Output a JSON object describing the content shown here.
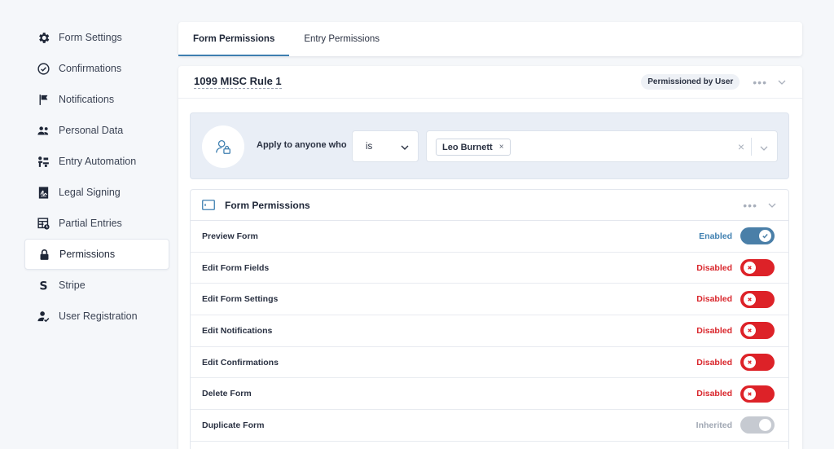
{
  "sidebar": {
    "items": [
      {
        "label": "Form Settings",
        "icon": "gear-icon"
      },
      {
        "label": "Confirmations",
        "icon": "check-circle-icon"
      },
      {
        "label": "Notifications",
        "icon": "flag-icon"
      },
      {
        "label": "Personal Data",
        "icon": "users-icon"
      },
      {
        "label": "Entry Automation",
        "icon": "automation-icon"
      },
      {
        "label": "Legal Signing",
        "icon": "signature-icon"
      },
      {
        "label": "Partial Entries",
        "icon": "partial-entries-icon"
      },
      {
        "label": "Permissions",
        "icon": "lock-icon"
      },
      {
        "label": "Stripe",
        "icon": "stripe-icon"
      },
      {
        "label": "User Registration",
        "icon": "user-check-icon"
      }
    ],
    "active": "Permissions"
  },
  "tabs": [
    {
      "label": "Form Permissions",
      "active": true
    },
    {
      "label": "Entry Permissions",
      "active": false
    }
  ],
  "rule": {
    "title": "1099 MISC Rule 1",
    "badge": "Permissioned by User",
    "condition": {
      "label": "Apply to anyone who",
      "operator": "is",
      "values": [
        "Leo Burnett"
      ],
      "chip_remove": "×",
      "clear": "×"
    },
    "permissions": {
      "title": "Form Permissions",
      "rows": [
        {
          "name": "Preview Form",
          "status": "Enabled",
          "state": "enabled"
        },
        {
          "name": "Edit Form Fields",
          "status": "Disabled",
          "state": "disabled"
        },
        {
          "name": "Edit Form Settings",
          "status": "Disabled",
          "state": "disabled"
        },
        {
          "name": "Edit Notifications",
          "status": "Disabled",
          "state": "disabled"
        },
        {
          "name": "Edit Confirmations",
          "status": "Disabled",
          "state": "disabled"
        },
        {
          "name": "Delete Form",
          "status": "Disabled",
          "state": "disabled"
        },
        {
          "name": "Duplicate Form",
          "status": "Inherited",
          "state": "inherited"
        }
      ]
    }
  },
  "colors": {
    "accent": "#3e7fb0",
    "enabled": "#4a7fa8",
    "disabled": "#dd2228",
    "inherited": "#c6cad1"
  }
}
